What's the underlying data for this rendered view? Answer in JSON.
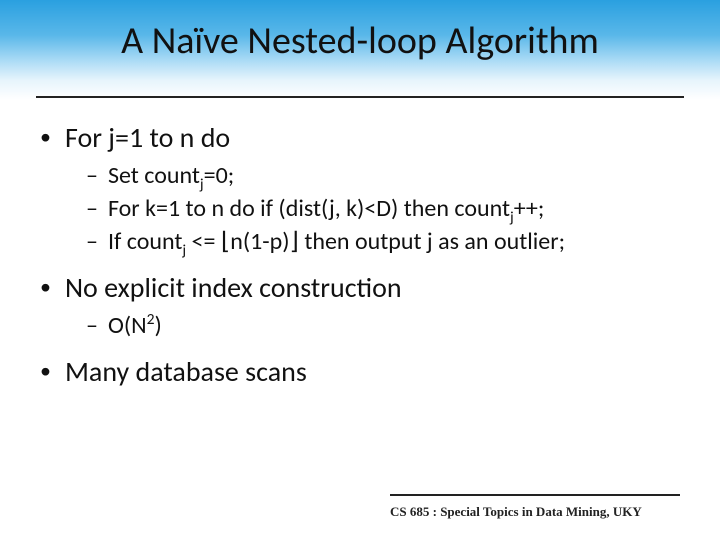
{
  "title": "A Naïve Nested-loop Algorithm",
  "bullets": {
    "b1_1": "For j=1 to n do",
    "b1_1_s1_pre": "Set count",
    "b1_1_s1_post": "=0;",
    "b1_1_s2_pre": "For k=1 to n do if (dist(j, k)<D) then count",
    "b1_1_s2_post": "++;",
    "b1_1_s3_pre": "If count",
    "b1_1_s3_mid": " <= ⌊n(1-p)⌋ then output j as an outlier;",
    "b1_2": "No explicit index construction",
    "b1_2_s1_pre": "O(N",
    "b1_2_s1_post": ")",
    "b1_3": "Many database scans"
  },
  "sub_j": "j",
  "sup_2": "2",
  "footer": "CS 685 : Special Topics in Data Mining, UKY"
}
